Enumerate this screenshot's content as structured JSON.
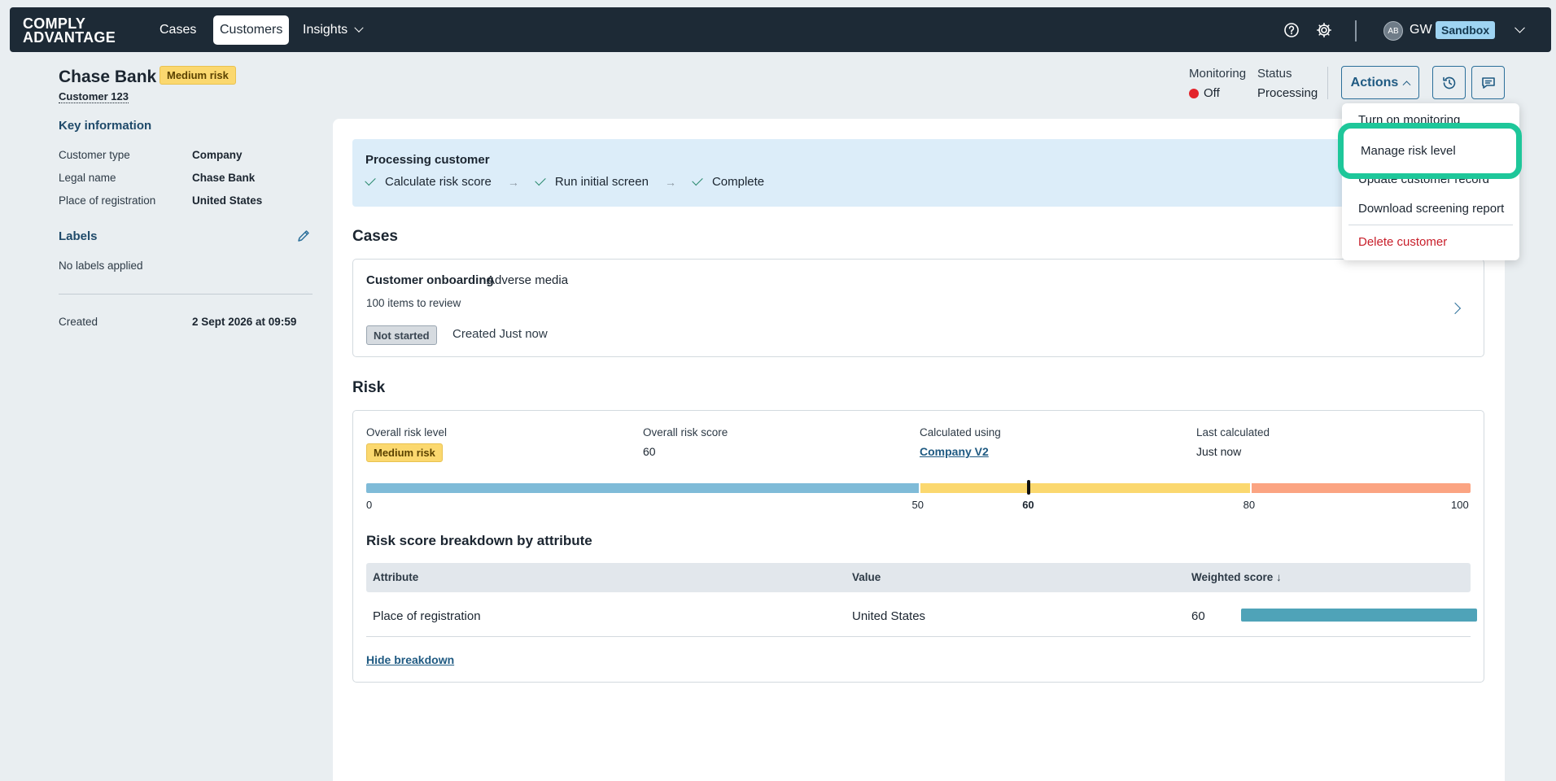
{
  "nav": {
    "logo_line1": "COMPLY",
    "logo_line2": "ADVANTAGE",
    "links": [
      {
        "label": "Cases"
      },
      {
        "label": "Customers"
      },
      {
        "label": "Insights"
      }
    ],
    "avatar": "AB",
    "user_initials": "GW",
    "env_badge": "Sandbox"
  },
  "header": {
    "customer_name": "Chase Bank",
    "risk_badge": "Medium risk",
    "customer_id": "Customer 123",
    "monitoring_label": "Monitoring",
    "monitoring_value": "Off",
    "status_label": "Status",
    "status_value": "Processing",
    "actions_label": "Actions"
  },
  "sidebar": {
    "key_info_title": "Key information",
    "fields": [
      {
        "label": "Customer type",
        "value": "Company"
      },
      {
        "label": "Legal name",
        "value": "Chase Bank"
      },
      {
        "label": "Place of registration",
        "value": "United States"
      }
    ],
    "labels_title": "Labels",
    "labels_empty": "No labels applied",
    "created_label": "Created",
    "created_value": "2 Sept 2026 at 09:59"
  },
  "processing": {
    "title": "Processing customer",
    "steps": [
      "Calculate risk score",
      "Run initial screen",
      "Complete"
    ],
    "arrow": "→"
  },
  "cases": {
    "title": "Cases",
    "case_type": "Customer onboarding",
    "case_sub": "Adverse media",
    "count": "100 items to review",
    "status": "Not started",
    "created": "Created Just now"
  },
  "risk": {
    "title": "Risk",
    "overall_level_label": "Overall risk level",
    "overall_level_value": "Medium risk",
    "overall_score_label": "Overall risk score",
    "overall_score_value": "60",
    "calc_label": "Calculated using",
    "calc_value": "Company V2",
    "last_label": "Last calculated",
    "last_value": "Just now",
    "scale_ticks": [
      "0",
      "50",
      "60",
      "80",
      "100"
    ],
    "score": 60,
    "bands": [
      {
        "from": 0,
        "to": 50,
        "color": "#7fbbd8"
      },
      {
        "from": 50,
        "to": 80,
        "color": "#fbd86f"
      },
      {
        "from": 80,
        "to": 100,
        "color": "#fba482"
      }
    ],
    "breakdown_title": "Risk score breakdown by attribute",
    "columns": [
      "Attribute",
      "Value",
      "Weighted score ↓"
    ],
    "rows": [
      {
        "attribute": "Place of registration",
        "value": "United States",
        "score": "60"
      }
    ],
    "hide_link": "Hide breakdown"
  },
  "actions_menu": {
    "items": [
      "Turn on monitoring",
      "Manage risk level",
      "Update customer record",
      "Download screening report",
      "Delete customer"
    ]
  }
}
